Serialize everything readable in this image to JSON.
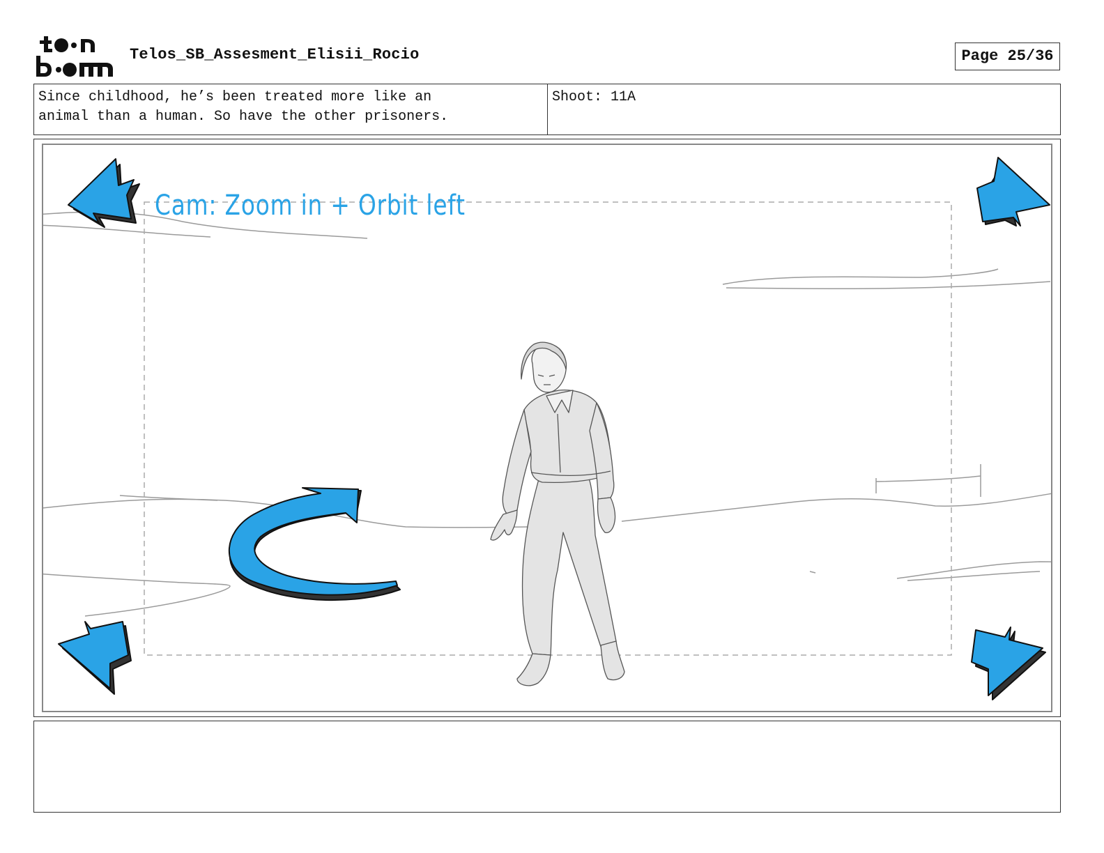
{
  "header": {
    "logo_text": "toon boom",
    "project_title": "Telos_SB_Assesment_Elisii_Rocio",
    "page_label": "Page 25/36"
  },
  "panel_info": {
    "dialogue": "Since childhood, he’s been treated more like an\nanimal than a human. So have the other prisoners.",
    "shoot": "Shoot: 11A"
  },
  "panel": {
    "camera_note": "Cam: Zoom in + Orbit left",
    "arrow_color": "#2aa3e6",
    "icons": [
      "zoom-arrow-icon",
      "orbit-arrow-icon",
      "character-sketch"
    ]
  },
  "notes": {
    "text": ""
  }
}
